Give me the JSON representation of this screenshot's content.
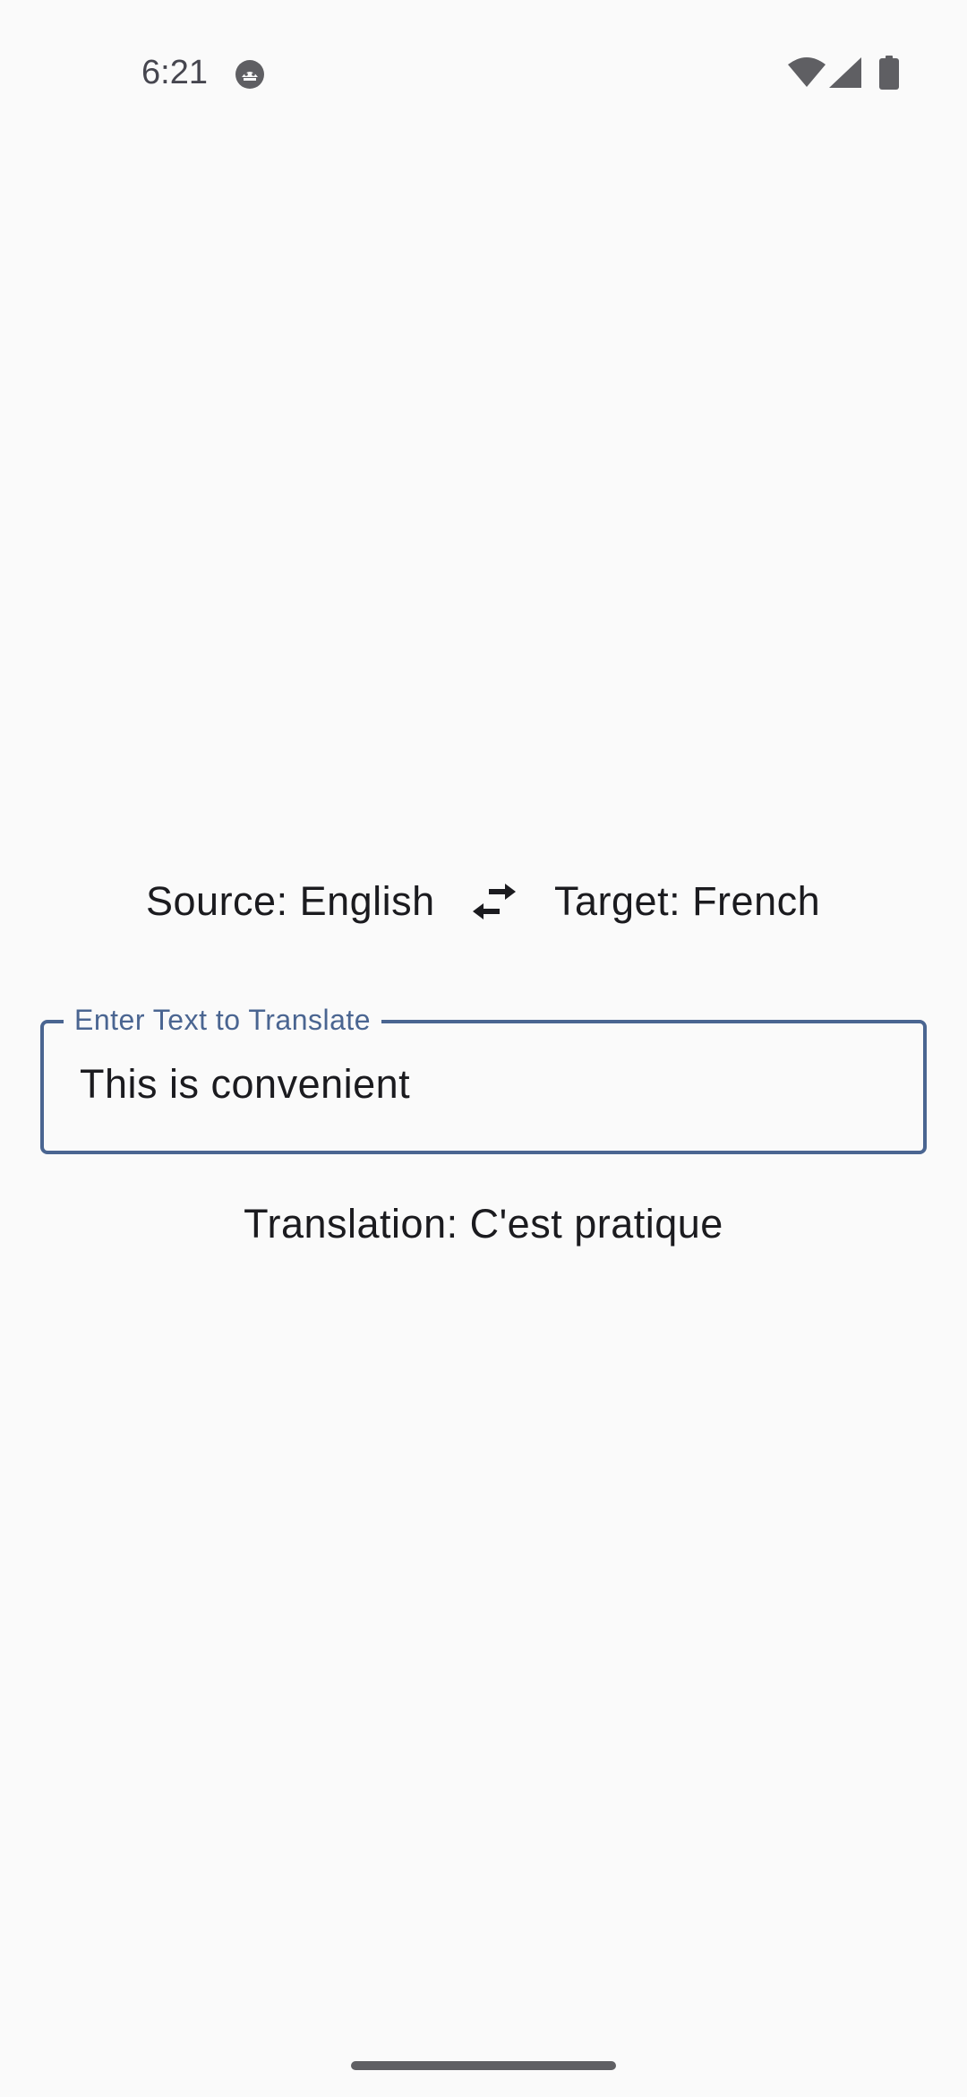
{
  "status_bar": {
    "time": "6:21"
  },
  "languages": {
    "source_label": "Source: English",
    "target_label": "Target: French"
  },
  "input": {
    "label": "Enter Text to Translate",
    "value": "This is convenient"
  },
  "translation": {
    "text": "Translation: C'est pratique"
  },
  "colors": {
    "accent": "#4a6591",
    "background": "#fafafa",
    "text": "#1b1b1f"
  },
  "icons": {
    "swap": "swap-horiz-icon",
    "wifi": "wifi-icon",
    "signal": "cell-signal-icon",
    "battery": "battery-icon",
    "notification": "android-head-icon"
  }
}
